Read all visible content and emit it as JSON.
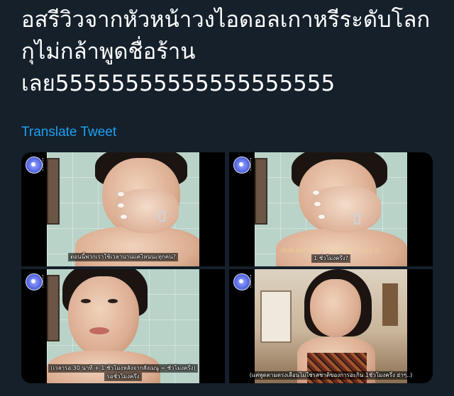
{
  "tweet": {
    "text_lines": [
      "อสรีวิวจากหัวหน้าวงไอดอลเกาหรีระดับโลก",
      "กุไม่กล้าพูดชื่อร้าน",
      "เลย55555555555555555555"
    ],
    "translate_label": "Translate Tweet"
  },
  "media": {
    "tiles": [
      {
        "subtitle": "ตอนนี้พวกเราใช้เวลานานแค่ไหนนะทุกคน?",
        "background": "tiles"
      },
      {
        "subtitle": "1 ชั่วโมงครึ่ง?",
        "faint_caption": "(80분 30분+30분 = 1시간 30분 = 1시간 반)",
        "background": "tiles"
      },
      {
        "subtitle_lines": [
          "(เวลารอ 30 นาที + 1 ชั่วโมงหลังจากสั่งเมนู = ชั่วโมงครึ่ง)",
          "รอชั่วโมงครึ่ง"
        ],
        "background": "tiles"
      },
      {
        "subtitle": "(แค่พูดตามตรงเลือนไม่ใช่รสชาติของการอะกิน 1ชั่วโมงครึ่ง ฮ่าๆ..)",
        "background": "room"
      }
    ]
  },
  "colors": {
    "background": "#15202b",
    "text": "#ffffff",
    "link": "#1da1f2"
  }
}
